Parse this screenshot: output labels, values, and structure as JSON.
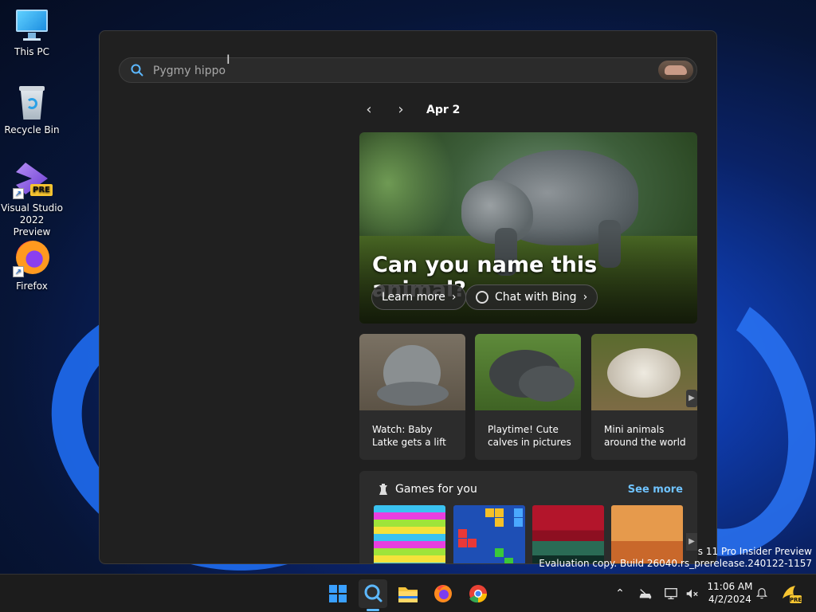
{
  "desktop": {
    "icons": [
      {
        "label": "This PC"
      },
      {
        "label": "Recycle Bin"
      },
      {
        "label": "Visual Studio 2022 Preview",
        "line1": "Visual Studio",
        "line2": "2022 Preview",
        "badge": "PRE"
      },
      {
        "label": "Firefox"
      }
    ]
  },
  "search": {
    "placeholder": "Pygmy hippo",
    "value": ""
  },
  "highlights": {
    "date": "Apr 2",
    "hero": {
      "title": "Can you name this animal?",
      "learn_more": "Learn more",
      "chat_with_bing": "Chat with Bing"
    },
    "cards": [
      {
        "caption": "Watch: Baby Latke gets a lift"
      },
      {
        "caption": "Playtime! Cute calves in pictures"
      },
      {
        "caption": "Mini animals around the world"
      }
    ],
    "games": {
      "title": "Games for you",
      "see_more": "See more"
    }
  },
  "watermark": {
    "line1": "s 11 Pro Insider Preview",
    "line2": "Evaluation copy. Build 26040.rs_prerelease.240122-1157"
  },
  "taskbar": {
    "apps": [
      "start",
      "search",
      "file-explorer",
      "firefox",
      "chrome"
    ],
    "active": "search"
  },
  "tray": {
    "time": "11:06 AM",
    "date": "4/2/2024"
  },
  "colors": {
    "accent": "#5cb8ff",
    "link": "#6fc3ff",
    "flyout_bg": "#202020",
    "card_bg": "#2c2c2c"
  }
}
